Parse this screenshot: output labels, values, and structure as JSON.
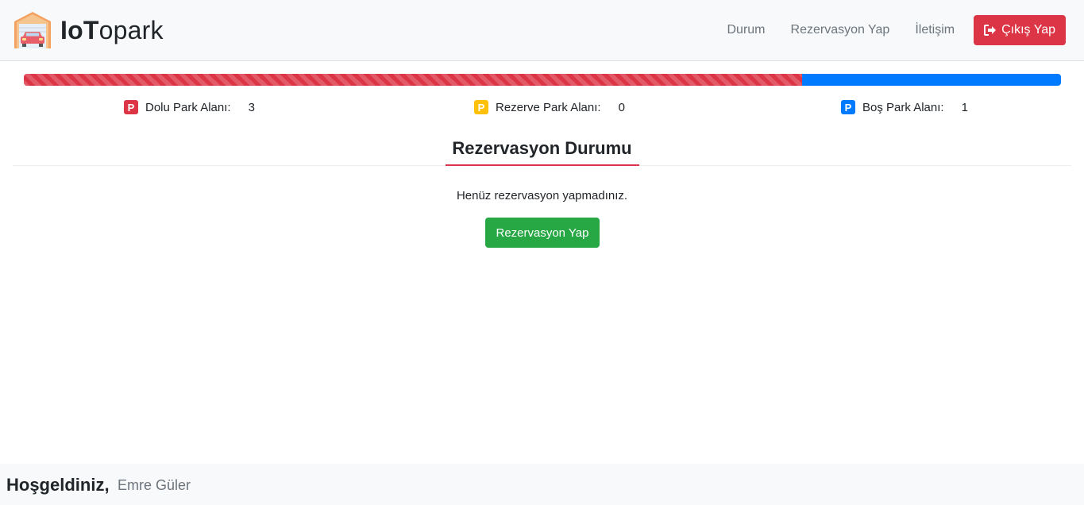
{
  "brand": {
    "bold": "IoT",
    "rest": "opark"
  },
  "nav": {
    "items": [
      "Durum",
      "Rezervasyon Yap",
      "İletişim"
    ],
    "logout_label": "Çıkış Yap"
  },
  "parking": {
    "occupied_fraction": 0.75,
    "reserved_fraction": 0,
    "free_fraction": 0.25,
    "stats": [
      {
        "icon": "parking-icon",
        "label": "Dolu Park Alanı:",
        "value": "3",
        "color": "#dc3545"
      },
      {
        "icon": "parking-icon",
        "label": "Rezerve Park Alanı:",
        "value": "0",
        "color": "#ffc107"
      },
      {
        "icon": "parking-icon",
        "label": "Boş Park Alanı:",
        "value": "1",
        "color": "#007bff"
      }
    ]
  },
  "reservation": {
    "title": "Rezervasyon Durumu",
    "empty_message": "Henüz rezervasyon yapmadınız.",
    "button_label": "Rezervasyon Yap"
  },
  "footer": {
    "welcome": "Hoşgeldiniz,",
    "user": "Emre Güler"
  },
  "colors": {
    "danger": "#dc3545",
    "warning": "#ffc107",
    "primary": "#007bff",
    "success": "#28a745"
  }
}
